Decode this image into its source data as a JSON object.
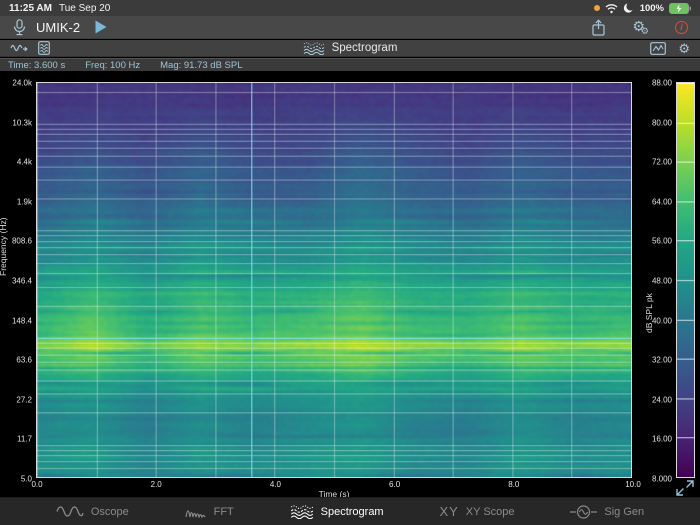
{
  "colors": {
    "accent_blue": "#a9c6d6",
    "play_blue": "#7cb8d9",
    "alert_red": "#dd4b39",
    "battery_green": "#6dc45f",
    "recording_orange": "#f0a33c",
    "cursor_cyan": "#7de2ea",
    "active_tab_text": "#fdfdfd",
    "inactive_tab_text": "#8b8b8b",
    "readout_text": "#9ec4d6"
  },
  "status_bar": {
    "time": "11:25 AM",
    "date": "Tue Sep 20",
    "battery_percent": "100%",
    "icons": [
      "recording-dot",
      "wifi-icon",
      "moon-icon",
      "battery-icon"
    ]
  },
  "toolbar": {
    "device_name": "UMIK-2",
    "icons": [
      "microphone-icon",
      "play-button",
      "share-icon",
      "settings-gears-icon",
      "info-icon"
    ],
    "gear_glyph": "⚙"
  },
  "nav": {
    "title": "Spectrogram",
    "left_icons": [
      "waveform-capture-icon",
      "snapshot-file-icon"
    ],
    "right_icons": [
      "chart-preview-icon",
      "gear-icon"
    ]
  },
  "readout": {
    "time": "Time: 3.600 s",
    "freq": "Freq: 100 Hz",
    "mag": "Mag: 91.73 dB SPL"
  },
  "tabs": [
    {
      "id": "oscope",
      "label": "Oscope",
      "icon": "sine-wave-icon",
      "active": false
    },
    {
      "id": "fft",
      "label": "FFT",
      "icon": "fft-peaks-icon",
      "active": false
    },
    {
      "id": "spectrogram",
      "label": "Spectrogram",
      "icon": "spectrogram-icon",
      "active": true
    },
    {
      "id": "xyscope",
      "label": "XY Scope",
      "icon": "xy-icon",
      "xy_glyph": "XY",
      "active": false
    },
    {
      "id": "siggen",
      "label": "Sig Gen",
      "icon": "sig-gen-icon",
      "active": false
    }
  ],
  "chart_data": {
    "type": "heatmap",
    "title": "Spectrogram",
    "xlabel": "Time (s)",
    "ylabel": "Frequency (Hz)",
    "colorbar_label": "dB SPL pk",
    "x_range": [
      0,
      10
    ],
    "x_ticks": [
      "0.0",
      "2.0",
      "4.0",
      "6.0",
      "8.0",
      "10.0"
    ],
    "x_tick_values": [
      0,
      2,
      4,
      6,
      8,
      10
    ],
    "y_scale": "log",
    "y_range_hz": [
      5,
      24000
    ],
    "y_tick_labels": [
      "24.0k",
      "10.3k",
      "4.4k",
      "1.9k",
      "808.6",
      "346.4",
      "148.4",
      "63.6",
      "27.2",
      "11.7",
      "5.0"
    ],
    "colorbar_range": [
      8,
      88
    ],
    "colorbar_ticks": [
      "88.00",
      "80.00",
      "72.00",
      "64.00",
      "56.00",
      "48.00",
      "40.00",
      "32.00",
      "24.00",
      "16.00",
      "8.000"
    ],
    "colormap": "viridis",
    "colormap_stops": [
      {
        "t": 0.0,
        "c": "#440154"
      },
      {
        "t": 0.1,
        "c": "#482475"
      },
      {
        "t": 0.2,
        "c": "#414487"
      },
      {
        "t": 0.3,
        "c": "#355f8d"
      },
      {
        "t": 0.4,
        "c": "#2a788e"
      },
      {
        "t": 0.5,
        "c": "#21918c"
      },
      {
        "t": 0.6,
        "c": "#22a884"
      },
      {
        "t": 0.7,
        "c": "#42be71"
      },
      {
        "t": 0.8,
        "c": "#7ad151"
      },
      {
        "t": 0.9,
        "c": "#bddf26"
      },
      {
        "t": 1.0,
        "c": "#fde725"
      }
    ],
    "gridlines": {
      "vertical_every_s": 1,
      "horizontal": "log-decades",
      "color": "rgba(255,255,255,0.36)"
    },
    "cursor": {
      "time_s": 3.6,
      "freq_hz": 100,
      "mag_db_spl": 91.73
    },
    "grid": {
      "times_s": [
        0,
        0.91,
        1.82,
        2.73,
        3.64,
        4.55,
        5.45,
        6.36,
        7.27,
        8.18,
        9.09,
        10
      ],
      "freqs_hz": [
        24000,
        12000,
        6000,
        3000,
        1500,
        800,
        400,
        200,
        120,
        80,
        50,
        30,
        15,
        8,
        5
      ],
      "values_db": [
        [
          20,
          20,
          21,
          20,
          20,
          21,
          20,
          20,
          21,
          20,
          20,
          20
        ],
        [
          22,
          23,
          22,
          23,
          22,
          23,
          24,
          23,
          22,
          23,
          22,
          22
        ],
        [
          25,
          28,
          25,
          30,
          26,
          26,
          31,
          27,
          25,
          29,
          26,
          26
        ],
        [
          29,
          33,
          29,
          34,
          30,
          30,
          35,
          31,
          29,
          33,
          30,
          30
        ],
        [
          35,
          39,
          34,
          40,
          36,
          36,
          41,
          37,
          35,
          39,
          36,
          36
        ],
        [
          43,
          47,
          42,
          48,
          44,
          45,
          49,
          45,
          43,
          47,
          44,
          44
        ],
        [
          51,
          55,
          50,
          56,
          52,
          53,
          57,
          53,
          51,
          55,
          52,
          52
        ],
        [
          57,
          63,
          55,
          62,
          58,
          60,
          65,
          59,
          57,
          62,
          58,
          59
        ],
        [
          63,
          70,
          60,
          68,
          63,
          66,
          71,
          64,
          62,
          69,
          63,
          65
        ],
        [
          71,
          78,
          67,
          76,
          72,
          74,
          80,
          73,
          70,
          77,
          72,
          74
        ],
        [
          59,
          63,
          56,
          62,
          58,
          61,
          65,
          60,
          58,
          63,
          59,
          60
        ],
        [
          49,
          52,
          46,
          51,
          48,
          50,
          53,
          49,
          47,
          52,
          48,
          49
        ],
        [
          45,
          48,
          41,
          47,
          43,
          46,
          49,
          43,
          41,
          47,
          43,
          45
        ],
        [
          49,
          52,
          45,
          51,
          47,
          50,
          52,
          47,
          46,
          51,
          47,
          49
        ],
        [
          47,
          49,
          44,
          48,
          46,
          48,
          50,
          46,
          45,
          49,
          46,
          47
        ]
      ]
    },
    "texture_seed": 11
  }
}
